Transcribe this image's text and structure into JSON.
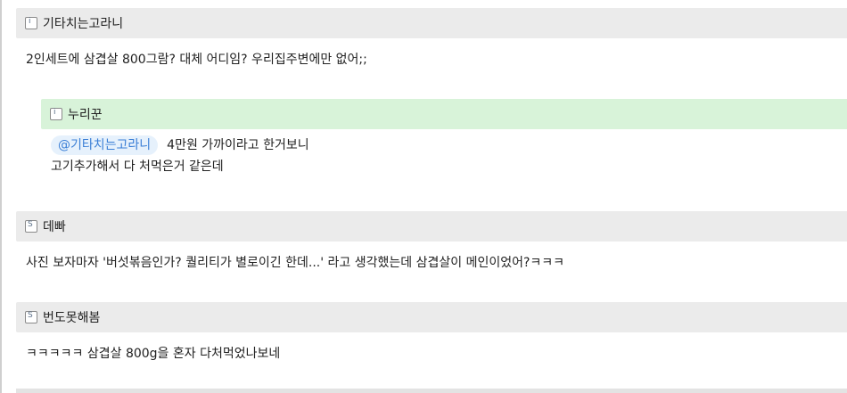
{
  "comments": [
    {
      "author": "기타치는고라니",
      "badge": "i",
      "text": "2인세트에 삼겹살 800그람? 대체 어디임? 우리집주변에만 없어;;"
    },
    {
      "author": "누리꾼",
      "badge": "i",
      "mention": "@기타치는고라니",
      "text_line1": "4만원 가까이라고 한거보니",
      "text_line2": "고기추가해서 다 처먹은거 같은데"
    },
    {
      "author": "데빠",
      "badge": "S",
      "text": "사진 보자마자 '버섯볶음인가? 퀄리티가 별로이긴 한데...' 라고 생각했는데 삼겹살이 메인이었어?ㅋㅋㅋ"
    },
    {
      "author": "번도못해봄",
      "badge": "S",
      "text": "ㅋㅋㅋㅋㅋ 삼겹살 800g을 혼자 다처먹었나보네"
    }
  ]
}
